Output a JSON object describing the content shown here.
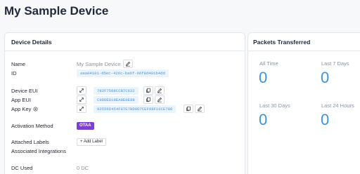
{
  "page": {
    "title": "My Sample Device"
  },
  "details": {
    "header": "Device Details",
    "name_label": "Name",
    "name_value": "My Sample Device",
    "id_label": "ID",
    "id_value": "aaa04101-d5ec-426c-ba6f-66f8d401b4dd",
    "device_eui_label": "Device EUI",
    "device_eui_value": "782F7568CCB7C632",
    "app_eui_label": "App EUI",
    "app_eui_value": "C9DDE819EA8E0E88",
    "app_key_label": "App Key",
    "app_key_value": "92556D454F87E7BD0D7CEF08F16CE786",
    "activation_label": "Activation Method",
    "activation_value": "OTAA",
    "attached_labels_label": "Attached Labels",
    "add_label_button": "+ Add Label",
    "associated_integrations_label": "Associated Integrations",
    "dc_used_label": "DC Used",
    "dc_used_value": "0 DC"
  },
  "packets": {
    "header": "Packets Transferred",
    "all_time_label": "All Time",
    "all_time_value": "0",
    "last7_label": "Last 7 Days",
    "last7_value": "0",
    "last30_label": "Last 30 Days",
    "last30_value": "0",
    "last24h_label": "Last 24 Hours",
    "last24h_value": "0"
  },
  "colors": {
    "accent": "#3a95df",
    "badge": "#7d3fd0",
    "pill_bg": "#eaf4fd",
    "pill_text": "#4c93d8"
  },
  "icons": [
    "edit-icon",
    "expand-icon",
    "copy-icon",
    "eye-icon"
  ]
}
